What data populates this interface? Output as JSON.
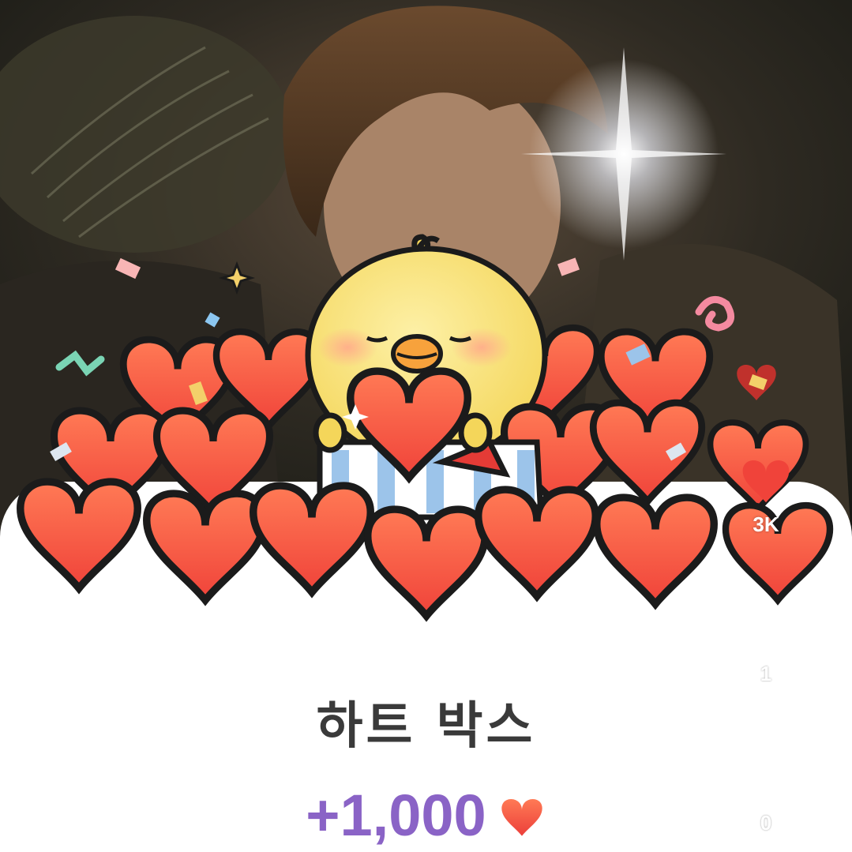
{
  "reward": {
    "title": "하트 박스",
    "amount": "+1,000"
  },
  "side_actions": {
    "heart_count": "3K",
    "like_count": "1",
    "comment_count": "0"
  },
  "colors": {
    "heart_red": "#f0433a",
    "amount_purple": "#8a63c6",
    "title_gray": "#3a3a3a",
    "chick_yellow": "#f9e27a"
  },
  "icons": [
    "heart-icon",
    "thumbs-up-icon",
    "comment-icon",
    "heart-small-icon"
  ]
}
